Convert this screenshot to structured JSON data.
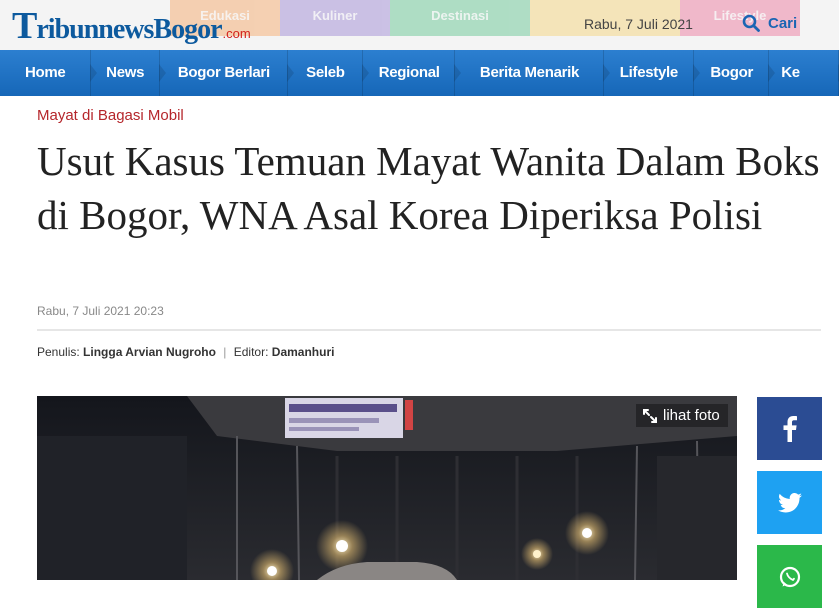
{
  "header": {
    "logo": {
      "part1": "T",
      "part2": "ribun",
      "part3": "newsBogor",
      "part4": ".com"
    },
    "category_strip": [
      {
        "label": "Edukasi",
        "color": "#f58d36"
      },
      {
        "label": "Kuliner",
        "color": "#7d62c9"
      },
      {
        "label": "Destinasi",
        "color": "#2fb36e"
      },
      {
        "label": "",
        "color": "#f4c54a"
      },
      {
        "label": "Lifestyle",
        "color": "#ea4c7f"
      }
    ],
    "date": "Rabu, 7 Juli 2021",
    "search_label": "Cari"
  },
  "nav": {
    "items": [
      "Home",
      "News",
      "Bogor Berlari",
      "Seleb",
      "Regional",
      "Berita Menarik",
      "Lifestyle",
      "Bogor",
      "Ke"
    ]
  },
  "article": {
    "kicker": "Mayat di Bagasi Mobil",
    "title": "Usut Kasus Temuan Mayat Wanita Dalam Boks di Bogor, WNA Asal Korea Diperiksa Polisi",
    "published": "Rabu, 7 Juli 2021 20:23",
    "writer_label": "Penulis:",
    "writer": "Lingga Arvian Nugroho",
    "editor_label": "Editor:",
    "editor": "Damanhuri",
    "photo_button": "lihat foto"
  },
  "share": {
    "facebook_icon": "facebook-icon",
    "twitter_icon": "twitter-icon",
    "whatsapp_icon": "whatsapp-icon"
  },
  "colors": {
    "brand_blue": "#1b65b3",
    "nav_blue": "#1f72c3",
    "kicker_red": "#b5262b",
    "facebook": "#2b4c93",
    "twitter": "#1ea1f2",
    "whatsapp": "#2bb84a"
  }
}
